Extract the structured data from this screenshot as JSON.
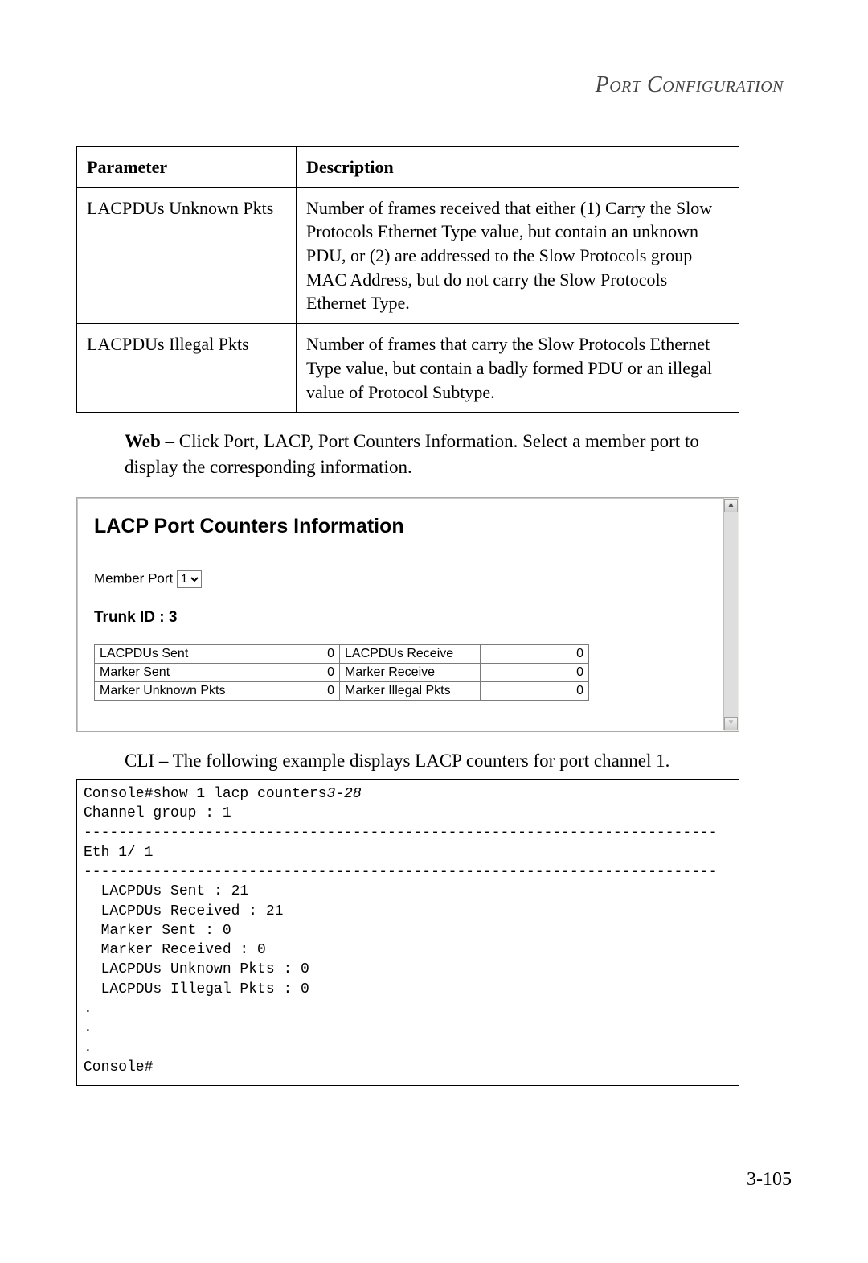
{
  "header": {
    "section_title": "Port Configuration"
  },
  "param_table": {
    "headers": [
      "Parameter",
      "Description"
    ],
    "rows": [
      {
        "param": "LACPDUs Unknown Pkts",
        "desc": "Number of frames received that either (1) Carry the Slow Protocols Ethernet Type value, but contain an unknown PDU, or (2) are addressed to the Slow Protocols group MAC Address, but do not carry the Slow Protocols Ethernet Type."
      },
      {
        "param": "LACPDUs Illegal Pkts",
        "desc": "Number of frames that carry the Slow Protocols Ethernet Type value, but contain a badly formed PDU or an illegal value of Protocol Subtype."
      }
    ]
  },
  "web_para": {
    "lead": "Web",
    "text": " – Click Port, LACP, Port Counters Information. Select a member port to display the corresponding information."
  },
  "web_panel": {
    "title": "LACP Port Counters Information",
    "member_port_label": "Member Port",
    "member_port_value": "1",
    "trunk_id_label": "Trunk ID : 3",
    "counters": [
      {
        "l1": "LACPDUs Sent",
        "v1": "0",
        "l2": "LACPDUs Receive",
        "v2": "0"
      },
      {
        "l1": "Marker Sent",
        "v1": "0",
        "l2": "Marker Receive",
        "v2": "0"
      },
      {
        "l1": "Marker Unknown Pkts",
        "v1": "0",
        "l2": "Marker Illegal Pkts",
        "v2": "0"
      }
    ]
  },
  "cli_para": {
    "lead": "CLI",
    "text": " – The following example displays LACP counters for port channel 1."
  },
  "cli_block": {
    "cmd_line_prefix": "Console#show 1 lacp counters",
    "cmd_line_ref": "3-28",
    "body": "Channel group : 1\n-------------------------------------------------------------------------\nEth 1/ 1\n-------------------------------------------------------------------------\n  LACPDUs Sent : 21\n  LACPDUs Received : 21\n  Marker Sent : 0\n  Marker Received : 0\n  LACPDUs Unknown Pkts : 0\n  LACPDUs Illegal Pkts : 0\n.\n.\n.\nConsole#"
  },
  "page_number": "3-105"
}
